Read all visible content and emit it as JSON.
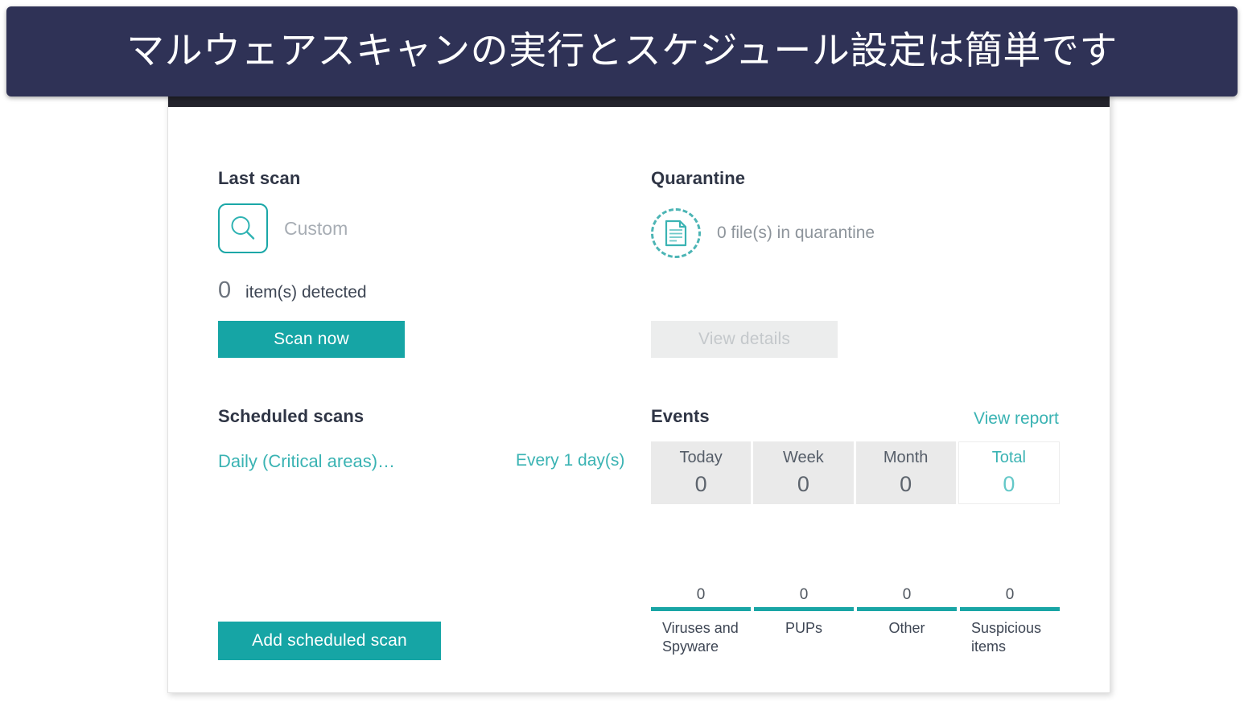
{
  "banner": {
    "text": "マルウェアスキャンの実行とスケジュール設定は簡単です",
    "background": "#2f3256",
    "text_color": "#ffffff"
  },
  "theme": {
    "accent": "#16a5a5",
    "accent_light": "#3ab3b3",
    "muted": "#9aa0a6",
    "tab_background": "#eaeaea",
    "titlebar": "#23232c"
  },
  "last_scan": {
    "title": "Last scan",
    "scan_type_icon": "magnifier-icon",
    "scan_type": "Custom",
    "detected_count": "0",
    "detected_label": "item(s) detected",
    "scan_now_label": "Scan now"
  },
  "quarantine": {
    "title": "Quarantine",
    "icon": "quarantined-file-icon",
    "status": "0 file(s) in quarantine",
    "view_details_label": "View details",
    "view_details_enabled": false
  },
  "scheduled_scans": {
    "title": "Scheduled scans",
    "item_name": "Daily (Critical areas)…",
    "frequency": "Every 1 day(s)",
    "add_button_label": "Add scheduled scan"
  },
  "events": {
    "title": "Events",
    "view_report_label": "View report",
    "tabs": [
      {
        "label": "Today",
        "value": "0",
        "selected": false
      },
      {
        "label": "Week",
        "value": "0",
        "selected": false
      },
      {
        "label": "Month",
        "value": "0",
        "selected": false
      },
      {
        "label": "Total",
        "value": "0",
        "selected": true
      }
    ],
    "stats": [
      {
        "label": "Viruses and Spyware",
        "value": "0"
      },
      {
        "label": "PUPs",
        "value": "0"
      },
      {
        "label": "Other",
        "value": "0"
      },
      {
        "label": "Suspicious items",
        "value": "0"
      }
    ]
  },
  "chart_data": {
    "type": "bar",
    "title": "Events",
    "categories": [
      "Viruses and Spyware",
      "PUPs",
      "Other",
      "Suspicious items"
    ],
    "values": [
      0,
      0,
      0,
      0
    ],
    "xlabel": "",
    "ylabel": "",
    "ylim": [
      0,
      0
    ]
  }
}
